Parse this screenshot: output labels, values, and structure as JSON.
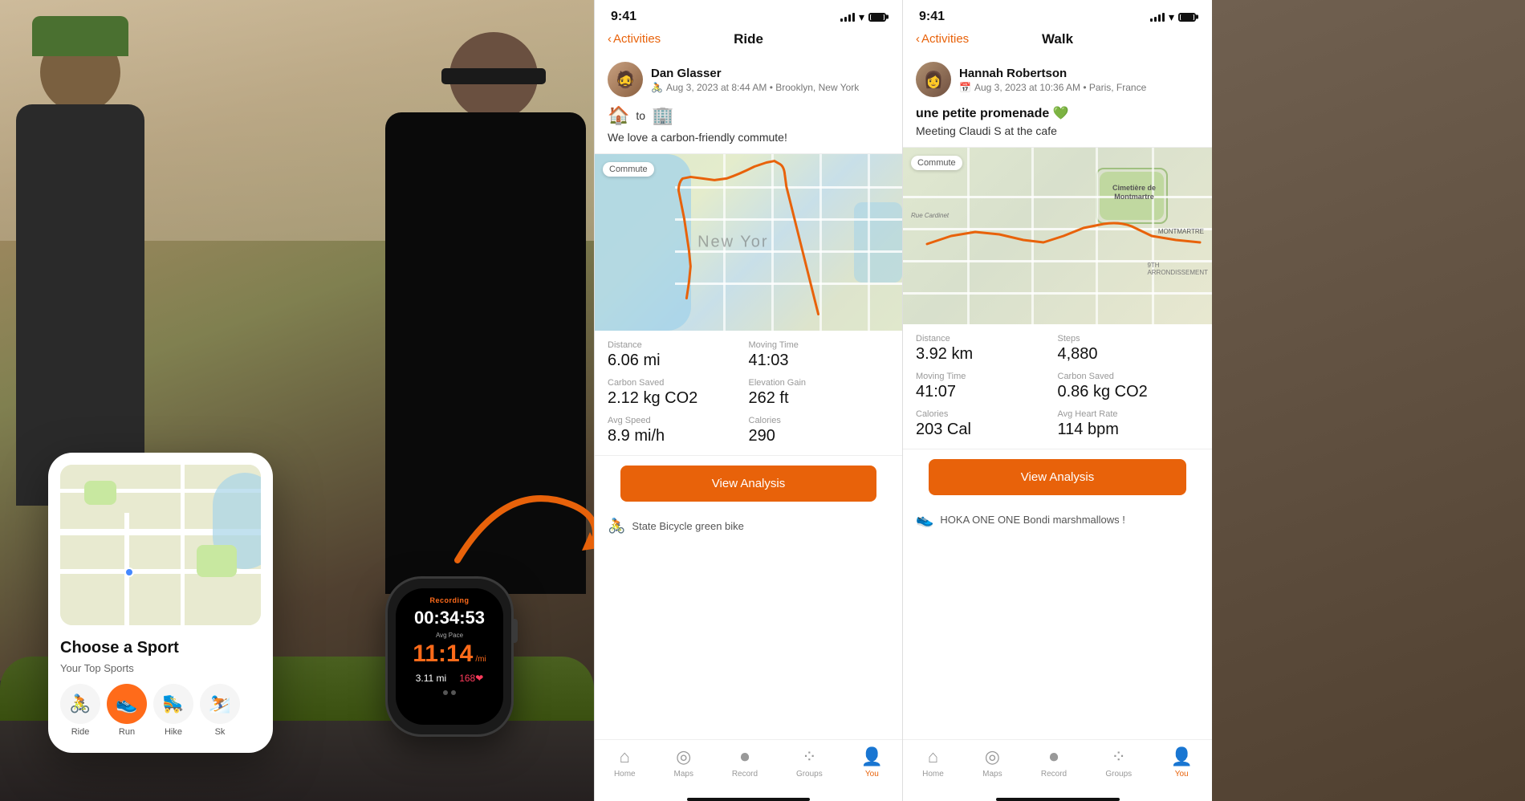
{
  "left_phone": {
    "map_label": "Map",
    "title": "Choose a Sport",
    "subtitle": "Your Top Sports",
    "sports": [
      {
        "label": "Ride",
        "icon": "🚴",
        "active": false
      },
      {
        "label": "Run",
        "icon": "👟",
        "active": true
      },
      {
        "label": "Hike",
        "icon": "🛼",
        "active": false
      },
      {
        "label": "Sk",
        "icon": "⛷️",
        "active": false
      }
    ]
  },
  "watch": {
    "recording_label": "Recording",
    "time": "00:34:53",
    "pace_label": "Avg Pace",
    "pace": "11:14",
    "pace_unit": "/mi",
    "distance": "3.11 mi",
    "heart_rate": "168"
  },
  "ride_screen": {
    "status_time": "9:41",
    "nav_back": "Activities",
    "nav_title": "Ride",
    "user_name": "Dan Glasser",
    "user_meta": "Aug 3, 2023 at 8:44 AM • Brooklyn, New York",
    "activity_text": "We love a carbon-friendly commute!",
    "activity_icons": [
      "🏠",
      "to",
      "🏢"
    ],
    "map_tag": "Commute",
    "stats": [
      {
        "label": "Distance",
        "value": "6.06 mi"
      },
      {
        "label": "Moving Time",
        "value": "41:03"
      },
      {
        "label": "Carbon Saved",
        "value": "2.12 kg CO2"
      },
      {
        "label": "Elevation Gain",
        "value": "262 ft"
      },
      {
        "label": "Avg Speed",
        "value": "8.9 mi/h"
      },
      {
        "label": "Calories",
        "value": "290"
      }
    ],
    "view_analysis_label": "View Analysis",
    "gear_name": "State Bicycle green bike",
    "nav_items": [
      {
        "label": "Home",
        "icon": "🏠",
        "active": false
      },
      {
        "label": "Maps",
        "icon": "🗺",
        "active": false
      },
      {
        "label": "Record",
        "icon": "⏺",
        "active": false
      },
      {
        "label": "Groups",
        "icon": "👥",
        "active": false
      },
      {
        "label": "You",
        "icon": "👤",
        "active": true
      }
    ]
  },
  "walk_screen": {
    "status_time": "9:41",
    "nav_back": "Activities",
    "nav_title": "Walk",
    "user_name": "Hannah Robertson",
    "user_meta": "Aug 3, 2023 at 10:36 AM • Paris, France",
    "activity_title": "une petite promenade 💚",
    "activity_text": "Meeting Claudi S at the cafe",
    "map_tag": "Commute",
    "stats": [
      {
        "label": "Distance",
        "value": "3.92 km"
      },
      {
        "label": "Steps",
        "value": "4,880"
      },
      {
        "label": "Moving Time",
        "value": "41:07"
      },
      {
        "label": "Carbon Saved",
        "value": "0.86 kg CO2"
      },
      {
        "label": "Calories",
        "value": "203 Cal"
      },
      {
        "label": "Avg Heart Rate",
        "value": "114 bpm"
      }
    ],
    "view_analysis_label": "View Analysis",
    "gear_name": "HOKA ONE ONE Bondi marshmallows !",
    "nav_items": [
      {
        "label": "Home",
        "icon": "🏠",
        "active": false
      },
      {
        "label": "Maps",
        "icon": "🗺",
        "active": false
      },
      {
        "label": "Record",
        "icon": "⏺",
        "active": false
      },
      {
        "label": "Groups",
        "icon": "👥",
        "active": false
      },
      {
        "label": "You",
        "icon": "👤",
        "active": true
      }
    ]
  }
}
